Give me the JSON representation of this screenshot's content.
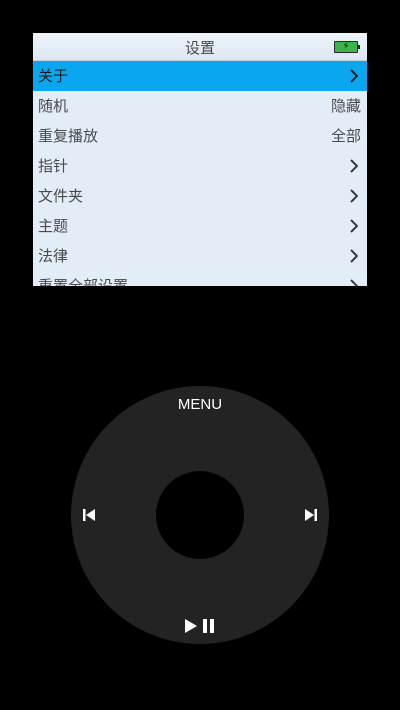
{
  "screen": {
    "title": "设置",
    "battery_icon": "battery-charging-icon",
    "battery_color": "#3bb54a",
    "selected_color": "#09a7f0",
    "background_color": "#e3edf8",
    "items": [
      {
        "label": "关于",
        "right": "",
        "icon": "chevron-right-icon"
      },
      {
        "label": "随机",
        "right": "隐藏",
        "icon": ""
      },
      {
        "label": "重复播放",
        "right": "全部",
        "icon": ""
      },
      {
        "label": "指针",
        "right": "",
        "icon": "chevron-right-icon"
      },
      {
        "label": "文件夹",
        "right": "",
        "icon": "chevron-right-icon"
      },
      {
        "label": "主题",
        "right": "",
        "icon": "chevron-right-icon"
      },
      {
        "label": "法律",
        "right": "",
        "icon": "chevron-right-icon"
      },
      {
        "label": "重置全部设置",
        "right": "",
        "icon": "chevron-right-icon"
      }
    ],
    "selected_index": 0
  },
  "wheel": {
    "menu_label": "MENU",
    "prev_icon": "skip-previous-icon",
    "next_icon": "skip-next-icon",
    "play_pause_icon": "play-pause-icon",
    "wheel_color": "#232323"
  }
}
